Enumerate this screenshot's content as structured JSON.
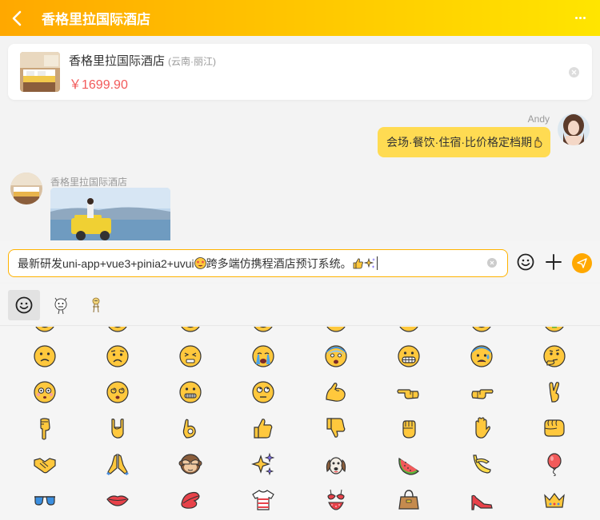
{
  "header": {
    "title": "香格里拉国际酒店",
    "back_icon": "chevron-left-icon",
    "more_icon": "ellipsis-icon"
  },
  "hotel_card": {
    "name": "香格里拉国际酒店",
    "location": "(云南·丽江)",
    "price": "￥1699.90"
  },
  "messages": [
    {
      "side": "right",
      "sender": "Andy",
      "text": "会场·餐饮·住宿·比价格定档期"
    },
    {
      "side": "left",
      "sender": "香格里拉国际酒店",
      "type": "image"
    }
  ],
  "input": {
    "value": "最新研发uni-app+vue3+pinia2+uvui",
    "value_tail": "跨多端仿携程酒店预订系统。"
  },
  "emoji_tabs": [
    "smile-face-icon",
    "meme-sticker-icon",
    "gif-sticker-icon"
  ],
  "emoji_rows": [
    [
      "slightly-frowning-face",
      "worried-face",
      "persevering-face",
      "crying-face",
      "fearful-face",
      "grimacing-face",
      "anxious-face",
      "thinking-face"
    ],
    [
      "flushed-face",
      "dizzy-face",
      "zipper-mouth-face",
      "face-rolling-eyes",
      "flexed-biceps",
      "backhand-index-left",
      "backhand-index-right",
      "crossed-fingers"
    ],
    [
      "backhand-index-down",
      "sign-of-horns",
      "ok-hand",
      "thumbs-up",
      "thumbs-down",
      "raised-fist",
      "raised-hand",
      "oncoming-fist"
    ],
    [
      "handshake",
      "folded-hands",
      "see-no-evil-monkey",
      "sparkles",
      "dog-face",
      "watermelon",
      "banana",
      "balloon"
    ],
    [
      "sunglasses",
      "mouth",
      "kiss-mark",
      "t-shirt",
      "bikini",
      "handbag",
      "high-heeled-shoe",
      "crown"
    ]
  ],
  "colors": {
    "header_start": "#ffa800",
    "header_end": "#ffe500",
    "bubble": "#ffdb52",
    "price": "#f25a5a",
    "accent": "#ffb300"
  }
}
